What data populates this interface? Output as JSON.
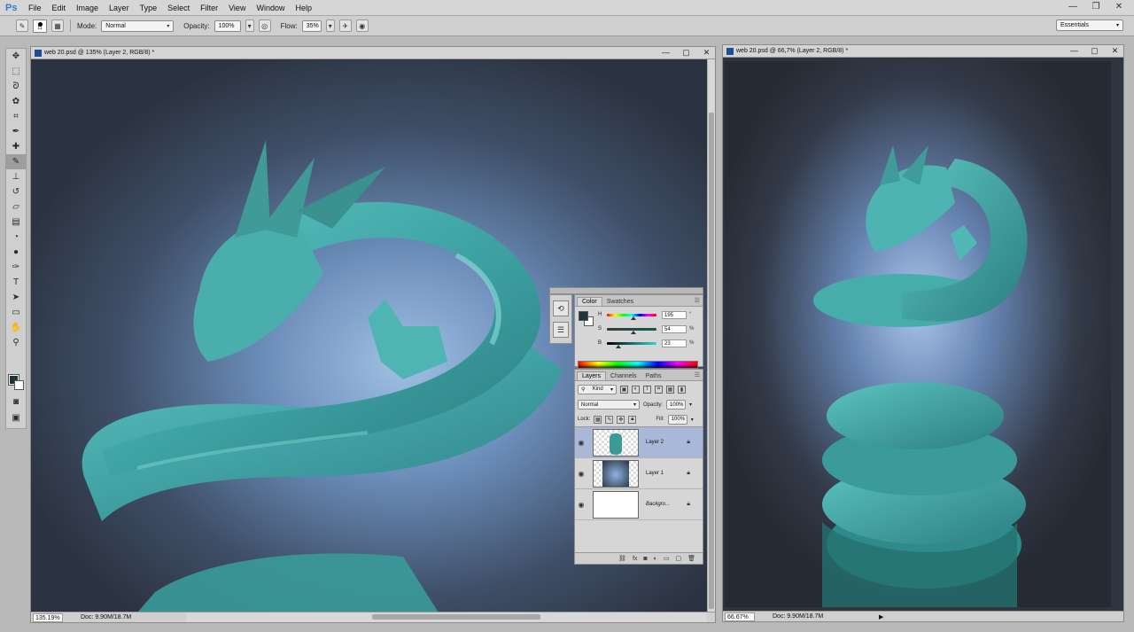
{
  "app": {
    "logo": "Ps",
    "menu": [
      "File",
      "Edit",
      "Image",
      "Layer",
      "Type",
      "Select",
      "Filter",
      "View",
      "Window",
      "Help"
    ],
    "window_controls": [
      "—",
      "❐",
      "✕"
    ]
  },
  "options_bar": {
    "brush_size": "11",
    "mode_label": "Mode:",
    "mode_value": "Normal",
    "opacity_label": "Opacity:",
    "opacity_value": "100%",
    "flow_label": "Flow:",
    "flow_value": "35%",
    "workspace": "Essentials"
  },
  "documents": [
    {
      "title": "web 20.psd @ 135% (Layer 2, RGB/8) *",
      "zoom": "135.19%",
      "doc_info": "Doc: 9.90M/18.7M"
    },
    {
      "title": "web 20.psd @ 66,7% (Layer 2, RGB/8) *",
      "zoom": "66.67%",
      "doc_info": "Doc: 9.90M/18.7M"
    }
  ],
  "color_panel": {
    "tabs": [
      "Color",
      "Swatches"
    ],
    "sliders": [
      {
        "label": "H",
        "value": "195",
        "unit": "°",
        "position": 0.54
      },
      {
        "label": "S",
        "value": "54",
        "unit": "%",
        "position": 0.54
      },
      {
        "label": "B",
        "value": "23",
        "unit": "%",
        "position": 0.23
      }
    ],
    "foreground": "#1c3637",
    "background": "#ffffff"
  },
  "layers_panel": {
    "tabs": [
      "Layers",
      "Channels",
      "Paths"
    ],
    "filter": "Kind",
    "blend_mode": "Normal",
    "opacity_label": "Opacity:",
    "opacity_value": "100%",
    "lock_label": "Lock:",
    "fill_label": "Fill:",
    "fill_value": "100%",
    "layers": [
      {
        "name": "Layer 2",
        "selected": true
      },
      {
        "name": "Layer 1",
        "selected": false
      },
      {
        "name": "Backgro...",
        "selected": false
      }
    ]
  },
  "colors": {
    "accent_teal": "#3fa7a5",
    "canvas_bg": "#303845",
    "selection": "#a9b8d8"
  }
}
